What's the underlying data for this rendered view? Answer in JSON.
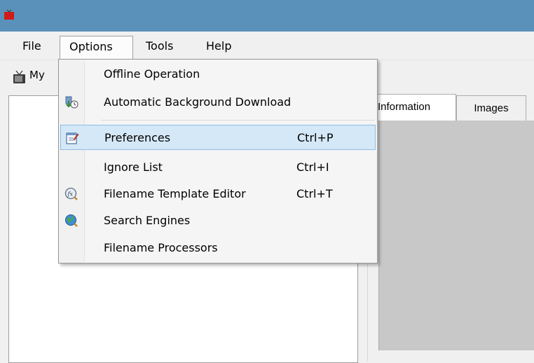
{
  "menubar": {
    "items": [
      {
        "label": "File"
      },
      {
        "label": "Options"
      },
      {
        "label": "Tools"
      },
      {
        "label": "Help"
      }
    ]
  },
  "toolbar": {
    "tab_label": "My"
  },
  "right_tabs": [
    {
      "label": "Information"
    },
    {
      "label": "Images"
    }
  ],
  "options_menu": {
    "items": [
      {
        "label": "Offline Operation",
        "shortcut": "",
        "icon": ""
      },
      {
        "label": "Automatic Background Download",
        "shortcut": "",
        "icon": "background-download-icon"
      },
      {
        "label": "Preferences",
        "shortcut": "Ctrl+P",
        "icon": "preferences-icon",
        "highlighted": true
      },
      {
        "label": "Ignore List",
        "shortcut": "Ctrl+I",
        "icon": ""
      },
      {
        "label": "Filename Template Editor",
        "shortcut": "Ctrl+T",
        "icon": "template-editor-icon"
      },
      {
        "label": "Search Engines",
        "shortcut": "",
        "icon": "search-engines-icon"
      },
      {
        "label": "Filename Processors",
        "shortcut": "",
        "icon": ""
      }
    ]
  },
  "colors": {
    "titlebar": "#5a91ba",
    "highlight": "#d5e8f7",
    "highlight_border": "#8fbde3"
  }
}
